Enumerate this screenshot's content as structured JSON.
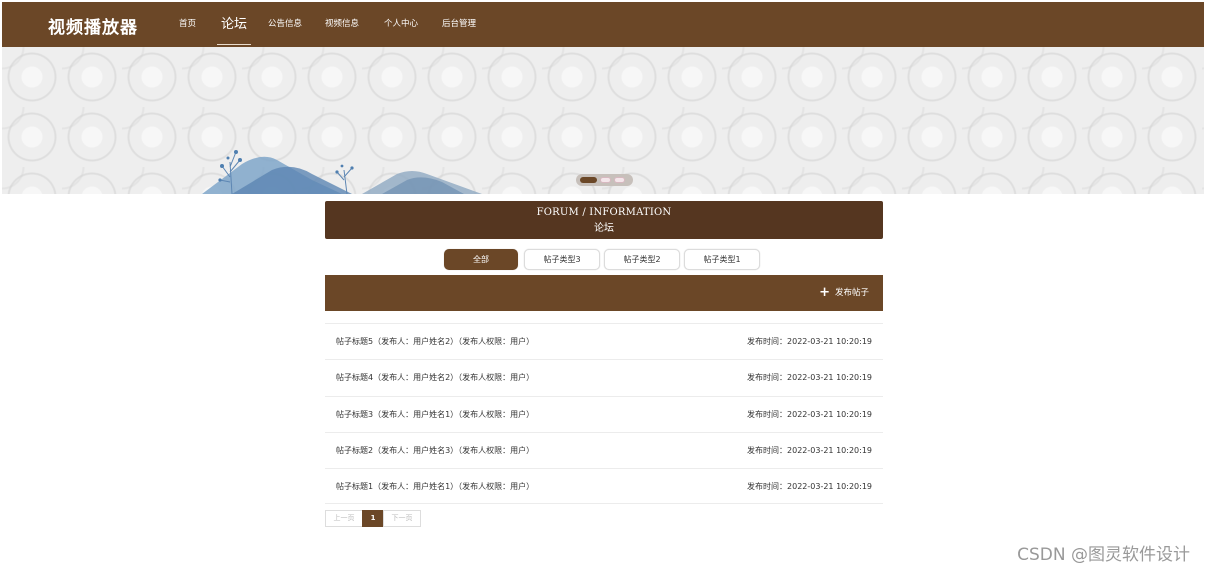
{
  "header": {
    "logo": "视频播放器",
    "nav": [
      {
        "label": "首页"
      },
      {
        "label": "论坛"
      },
      {
        "label": "公告信息"
      },
      {
        "label": "视频信息"
      },
      {
        "label": "个人中心"
      },
      {
        "label": "后台管理"
      }
    ],
    "active_index": 1
  },
  "banner": {
    "slides_count": 3,
    "active_slide": 1
  },
  "section": {
    "title_en": "FORUM / INFORMATION",
    "title_zh": "论坛"
  },
  "tabs": [
    {
      "label": "全部"
    },
    {
      "label": "帖子类型3"
    },
    {
      "label": "帖子类型2"
    },
    {
      "label": "帖子类型1"
    }
  ],
  "active_tab": 0,
  "actions": {
    "post_icon": "plus-icon",
    "post_label": "发布帖子"
  },
  "posts": [
    {
      "title": "帖子标题5（发布人：用户姓名2）（发布人权限：用户）",
      "time": "发布时间：2022-03-21 10:20:19"
    },
    {
      "title": "帖子标题4（发布人：用户姓名2）（发布人权限：用户）",
      "time": "发布时间：2022-03-21 10:20:19"
    },
    {
      "title": "帖子标题3（发布人：用户姓名1）（发布人权限：用户）",
      "time": "发布时间：2022-03-21 10:20:19"
    },
    {
      "title": "帖子标题2（发布人：用户姓名3）（发布人权限：用户）",
      "time": "发布时间：2022-03-21 10:20:19"
    },
    {
      "title": "帖子标题1（发布人：用户姓名1）（发布人权限：用户）",
      "time": "发布时间：2022-03-21 10:20:19"
    }
  ],
  "pagination": {
    "prev": "上一页",
    "current": "1",
    "next": "下一页"
  },
  "watermark": "CSDN @图灵软件设计",
  "colors": {
    "brand": "#6b4727",
    "title_bg": "#553620"
  }
}
